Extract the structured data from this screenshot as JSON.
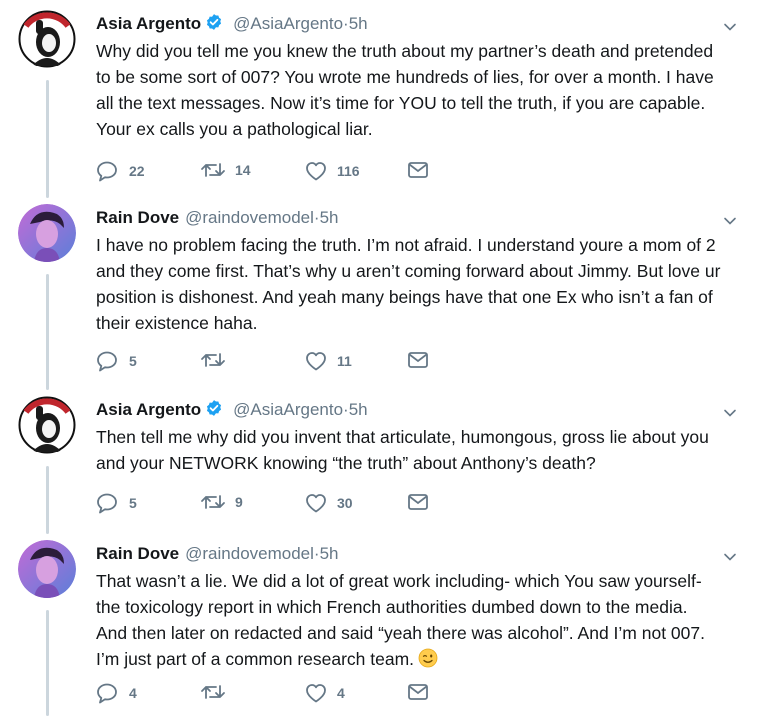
{
  "colors": {
    "text": "#14171a",
    "muted": "#657786",
    "verified": "#1da1f2",
    "thread": "#ccd6dd"
  },
  "tweets": [
    {
      "author": "Asia Argento",
      "verified": true,
      "handle": "@AsiaArgento",
      "time": "·5h",
      "lines": [
        "Why did you tell me you knew the truth about my partner’s death and pretended",
        "to be some sort of 007? You wrote me hundreds of lies, for over a month. I have",
        "all the text messages. Now it’s time for YOU to tell the truth, if you are capable.",
        "Your ex calls you a pathological liar."
      ],
      "replies": "22",
      "retweets": "14",
      "likes": "116"
    },
    {
      "author": "Rain Dove",
      "verified": false,
      "handle": "@raindovemodel",
      "time": "·5h",
      "lines": [
        "I have no problem facing the truth. I’m not afraid. I understand youre a mom of 2",
        "and they come first. That’s why u aren’t coming forward about Jimmy. But love ur",
        "position is dishonest. And yeah many beings have that one Ex who isn’t a fan of",
        "their existence haha."
      ],
      "replies": "5",
      "retweets": "",
      "likes": "11"
    },
    {
      "author": "Asia Argento",
      "verified": true,
      "handle": "@AsiaArgento",
      "time": "·5h",
      "lines": [
        "Then tell me why did you invent that articulate, humongous, gross lie about you",
        "and your NETWORK knowing “the truth” about Anthony’s death?"
      ],
      "replies": "5",
      "retweets": "9",
      "likes": "30"
    },
    {
      "author": "Rain Dove",
      "verified": false,
      "handle": "@raindovemodel",
      "time": "·5h",
      "lines": [
        "That wasn’t a lie. We did a lot of great work including- which You saw yourself-",
        "the toxicology report in which French authorities dumbed down to the media.",
        "And then later on redacted and said “yeah there was alcohol”. And I’m not 007.",
        "I’m just part of a common research team."
      ],
      "trailing_emoji": "winking-face",
      "replies": "4",
      "retweets": "",
      "likes": "4"
    }
  ]
}
